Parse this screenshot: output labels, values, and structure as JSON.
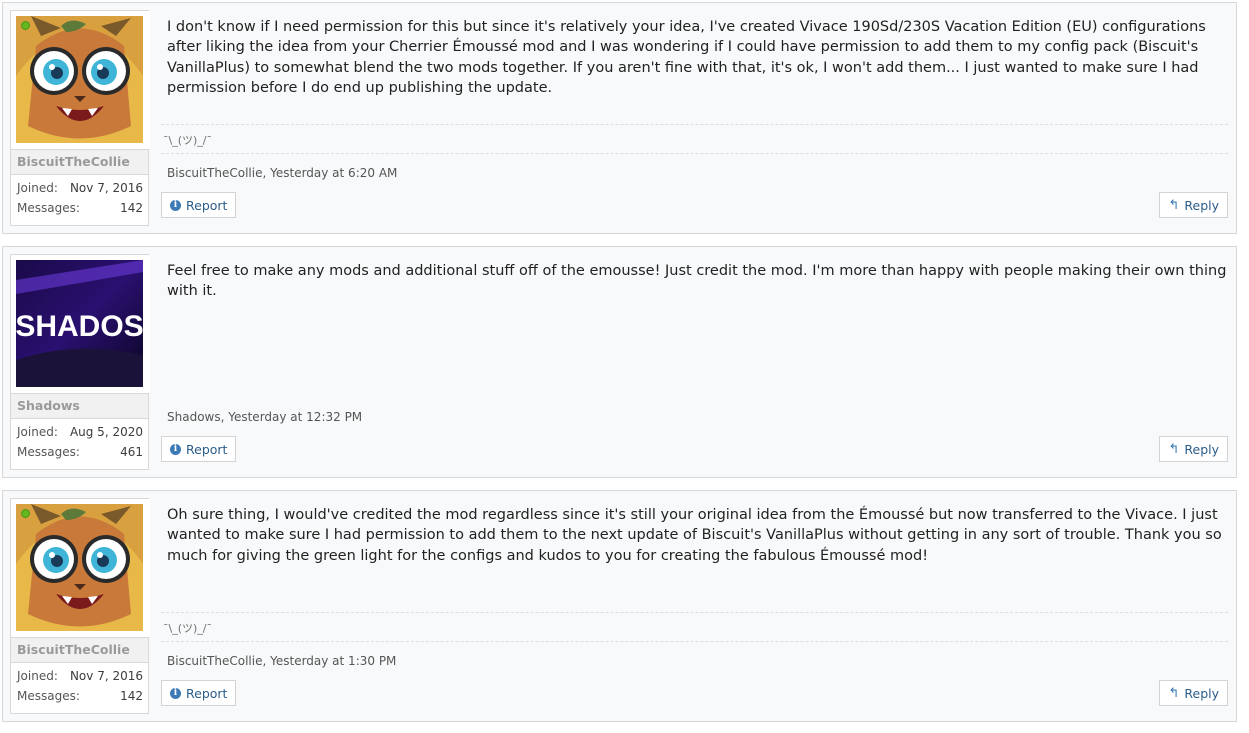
{
  "labels": {
    "joined": "Joined:",
    "messages": "Messages:",
    "report": "Report",
    "reply": "Reply"
  },
  "posts": [
    {
      "user": {
        "name": "BiscuitTheCollie",
        "joined": "Nov 7, 2016",
        "messages": "142",
        "online": true,
        "avatar": "cartoon-cat-with-glasses"
      },
      "body": "I don't know if I need permission for this but since it's relatively your idea, I've created Vivace 190Sd/230S Vacation Edition (EU) configurations after liking the idea from your Cherrier Émoussé mod and I was wondering if I could have permission to add them to my config pack (Biscuit's VanillaPlus) to somewhat blend the two mods together. If you aren't fine with that, it's ok, I won't add them... I just wanted to make sure I had permission before I do end up publishing the update.",
      "signature": "¯\\_(ツ)_/¯",
      "meta": "BiscuitTheCollie, Yesterday at 6:20 AM"
    },
    {
      "user": {
        "name": "Shadows",
        "joined": "Aug 5, 2020",
        "messages": "461",
        "online": false,
        "avatar": "shados-logo",
        "avatar_text": "SHADOS"
      },
      "body": "Feel free to make any mods and additional stuff off of the emousse! Just credit the mod. I'm more than happy with people making their own thing with it.",
      "meta": "Shadows, Yesterday at 12:32 PM"
    },
    {
      "user": {
        "name": "BiscuitTheCollie",
        "joined": "Nov 7, 2016",
        "messages": "142",
        "online": true,
        "avatar": "cartoon-cat-with-glasses"
      },
      "body": "Oh sure thing, I would've credited the mod regardless since it's still your original idea from the Émoussé but now transferred to the Vivace. I just wanted to make sure I had permission to add them to the next update of Biscuit's VanillaPlus without getting in any sort of trouble. Thank you so much for giving the green light for the configs and kudos to you for creating the fabulous Émoussé mod!",
      "signature": "¯\\_(ツ)_/¯",
      "meta": "BiscuitTheCollie, Yesterday at 1:30 PM"
    }
  ]
}
